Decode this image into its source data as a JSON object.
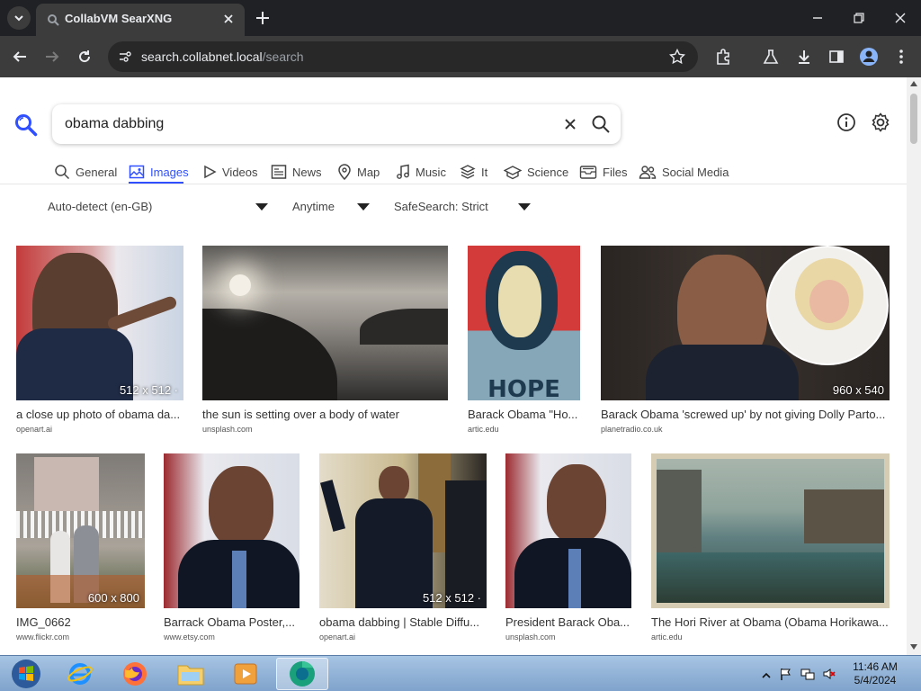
{
  "browser": {
    "tab_title": "CollabVM SearXNG",
    "url_host": "search.collabnet.local",
    "url_path": "/search"
  },
  "search": {
    "query": "obama dabbing"
  },
  "categories": [
    {
      "label": "General",
      "icon": "search-icon"
    },
    {
      "label": "Images",
      "icon": "image-icon",
      "active": true
    },
    {
      "label": "Videos",
      "icon": "play-icon"
    },
    {
      "label": "News",
      "icon": "newspaper-icon"
    },
    {
      "label": "Map",
      "icon": "map-pin-icon"
    },
    {
      "label": "Music",
      "icon": "music-note-icon"
    },
    {
      "label": "It",
      "icon": "layers-icon"
    },
    {
      "label": "Science",
      "icon": "school-icon"
    },
    {
      "label": "Files",
      "icon": "file-tray-icon"
    },
    {
      "label": "Social Media",
      "icon": "people-icon"
    }
  ],
  "filters": {
    "language": "Auto-detect (en-GB)",
    "time": "Anytime",
    "safesearch": "SafeSearch: Strict"
  },
  "results": [
    {
      "title": "a close up photo of obama da...",
      "source": "openart.ai",
      "size": "512 x 512 ·"
    },
    {
      "title": "the sun is setting over a body of water",
      "source": "unsplash.com",
      "size": ""
    },
    {
      "title": "Barack Obama \"Ho...",
      "source": "artic.edu",
      "size": ""
    },
    {
      "title": "Barack Obama 'screwed up' by not giving Dolly Parto...",
      "source": "planetradio.co.uk",
      "size": "960 x 540"
    },
    {
      "title": "IMG_0662",
      "source": "www.flickr.com",
      "size": "600 x 800"
    },
    {
      "title": "Barrack Obama Poster,...",
      "source": "www.etsy.com",
      "size": ""
    },
    {
      "title": "obama dabbing | Stable Diffu...",
      "source": "openart.ai",
      "size": "512 x 512 ·"
    },
    {
      "title": "President Barack Oba...",
      "source": "unsplash.com",
      "size": ""
    },
    {
      "title": "The Hori River at Obama (Obama Horikawa...",
      "source": "artic.edu",
      "size": ""
    }
  ],
  "taskbar": {
    "time": "11:46 AM",
    "date": "5/4/2024"
  },
  "colors": {
    "accent": "#3050ff",
    "chrome_dark": "#202124",
    "chrome_toolbar": "#3c3c3c"
  }
}
